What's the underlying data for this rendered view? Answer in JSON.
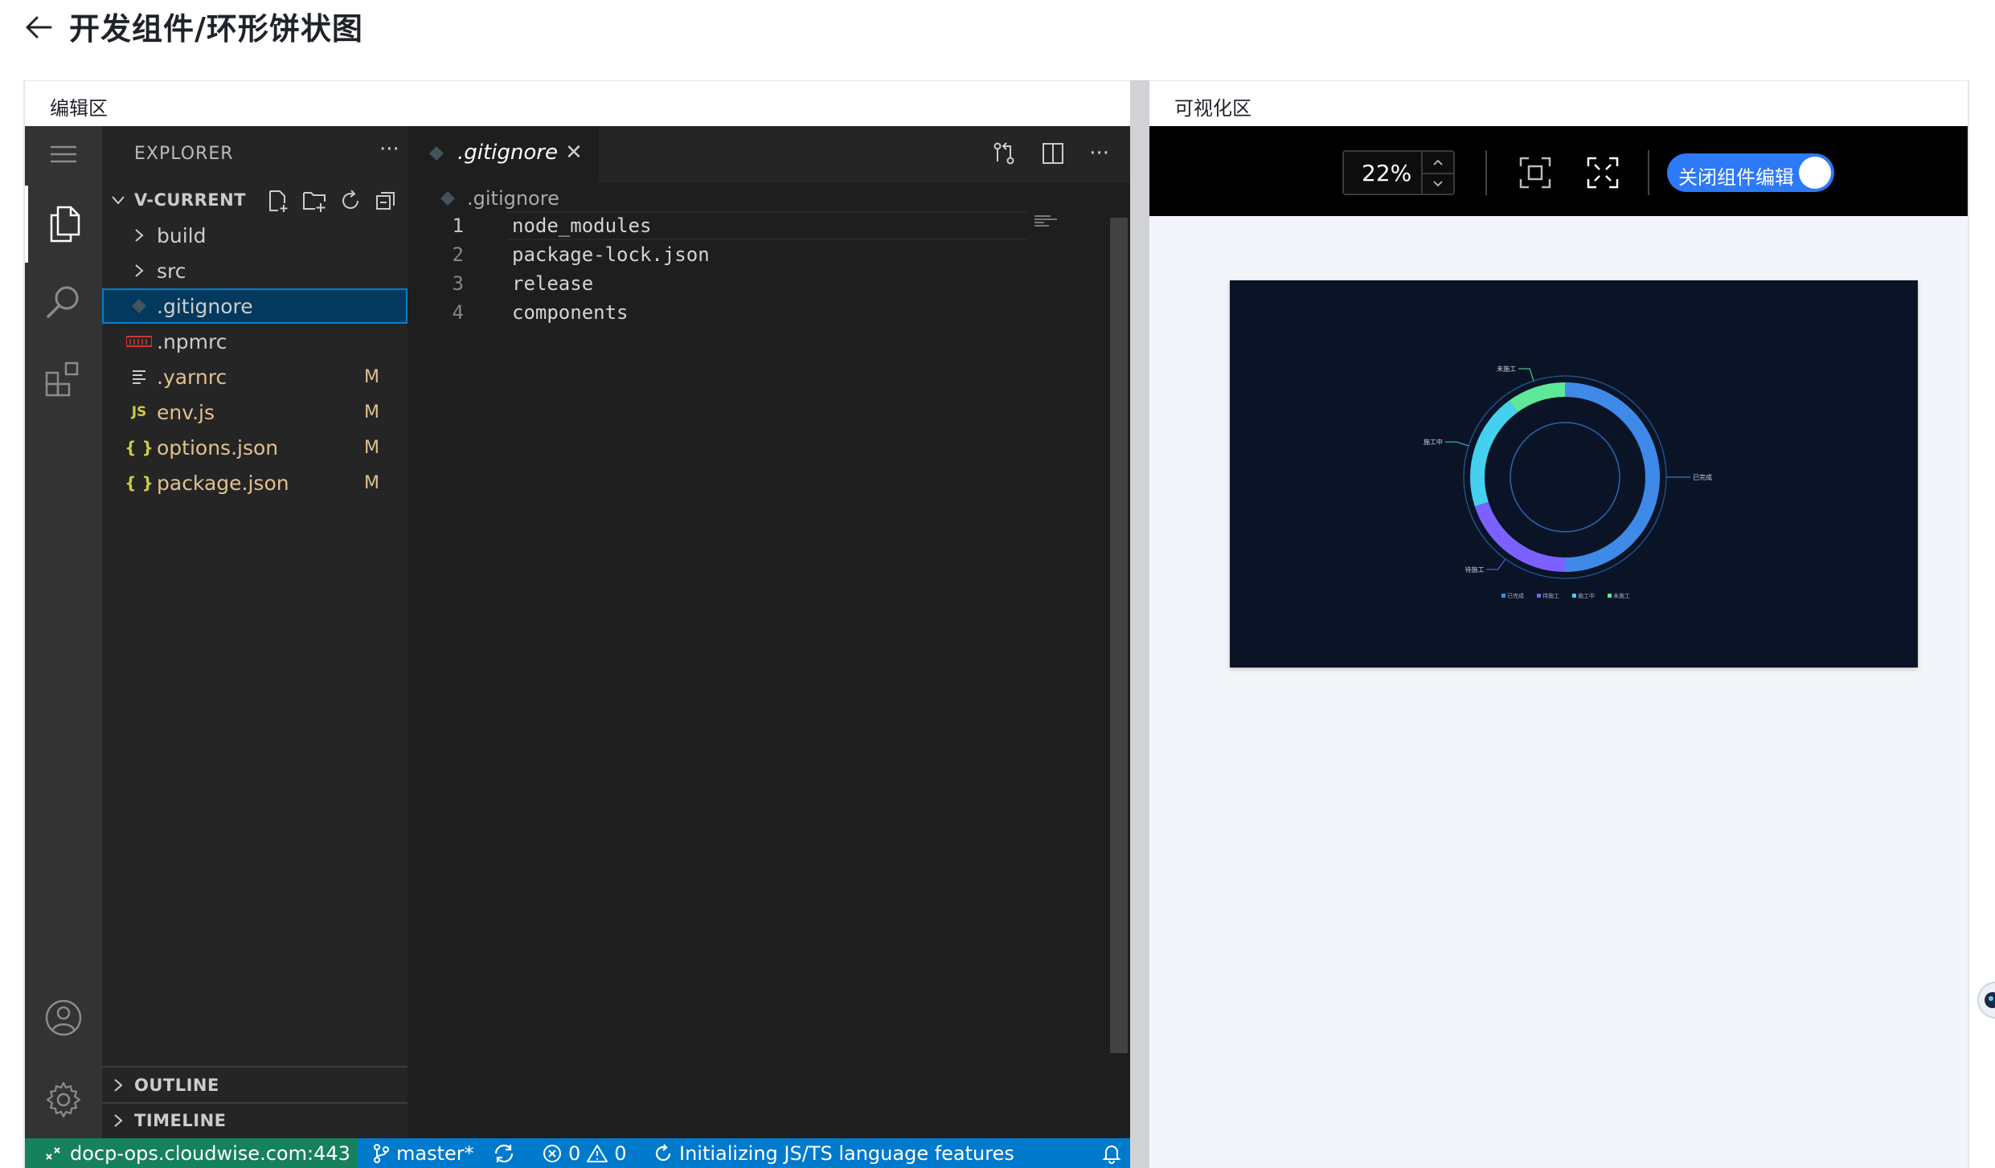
{
  "page": {
    "title": "开发组件/环形饼状图"
  },
  "edit_panel": {
    "label": "编辑区"
  },
  "viz_panel": {
    "label": "可视化区"
  },
  "vscode": {
    "explorer": {
      "title": "EXPLORER",
      "more": "···",
      "root": "V-CURRENT",
      "items": [
        {
          "label": "build",
          "type": "folder",
          "badge": ""
        },
        {
          "label": "src",
          "type": "folder",
          "badge": ""
        },
        {
          "label": ".gitignore",
          "type": "git-file",
          "badge": "",
          "selected": true
        },
        {
          "label": ".npmrc",
          "type": "npm-file",
          "badge": ""
        },
        {
          "label": ".yarnrc",
          "type": "text-file",
          "badge": "M"
        },
        {
          "label": "env.js",
          "type": "js-file",
          "badge": "M"
        },
        {
          "label": "options.json",
          "type": "json-file",
          "badge": "M"
        },
        {
          "label": "package.json",
          "type": "json-file",
          "badge": "M"
        }
      ],
      "outline": "OUTLINE",
      "timeline": "TIMELINE"
    },
    "editor": {
      "tab_label": ".gitignore",
      "breadcrumb": ".gitignore",
      "lines": [
        {
          "no": "1",
          "text": "node_modules"
        },
        {
          "no": "2",
          "text": "package-lock.json"
        },
        {
          "no": "3",
          "text": "release"
        },
        {
          "no": "4",
          "text": "components"
        }
      ]
    },
    "status": {
      "remote": "docp-ops.cloudwise.com:443",
      "branch": "master*",
      "errors": "0",
      "warnings": "0",
      "message": "Initializing JS/TS language features"
    }
  },
  "viz_toolbar": {
    "zoom": "22%",
    "toggle_label": "关闭组件编辑",
    "toggle_on": true,
    "collapse_label": "<"
  },
  "chart_data": {
    "type": "pie",
    "variant": "donut",
    "title": "",
    "categories": [
      "已完成",
      "待施工",
      "施工中",
      "未施工"
    ],
    "values": [
      50,
      20,
      20,
      10
    ],
    "colors": [
      "#3f8ae8",
      "#7b61ff",
      "#45d0f0",
      "#5ee89a"
    ],
    "slice_labels": [
      "已完成",
      "待施工",
      "施工中",
      "未施工"
    ],
    "legend": {
      "placement": "bottom",
      "items": [
        "已完成",
        "待施工",
        "施工中",
        "未施工"
      ]
    },
    "background": "#0b1426"
  },
  "colors": {
    "accent": "#2d79f6",
    "vscode_status": "#007acc",
    "vscode_remote": "#16825d",
    "modified": "#e2c08d"
  }
}
